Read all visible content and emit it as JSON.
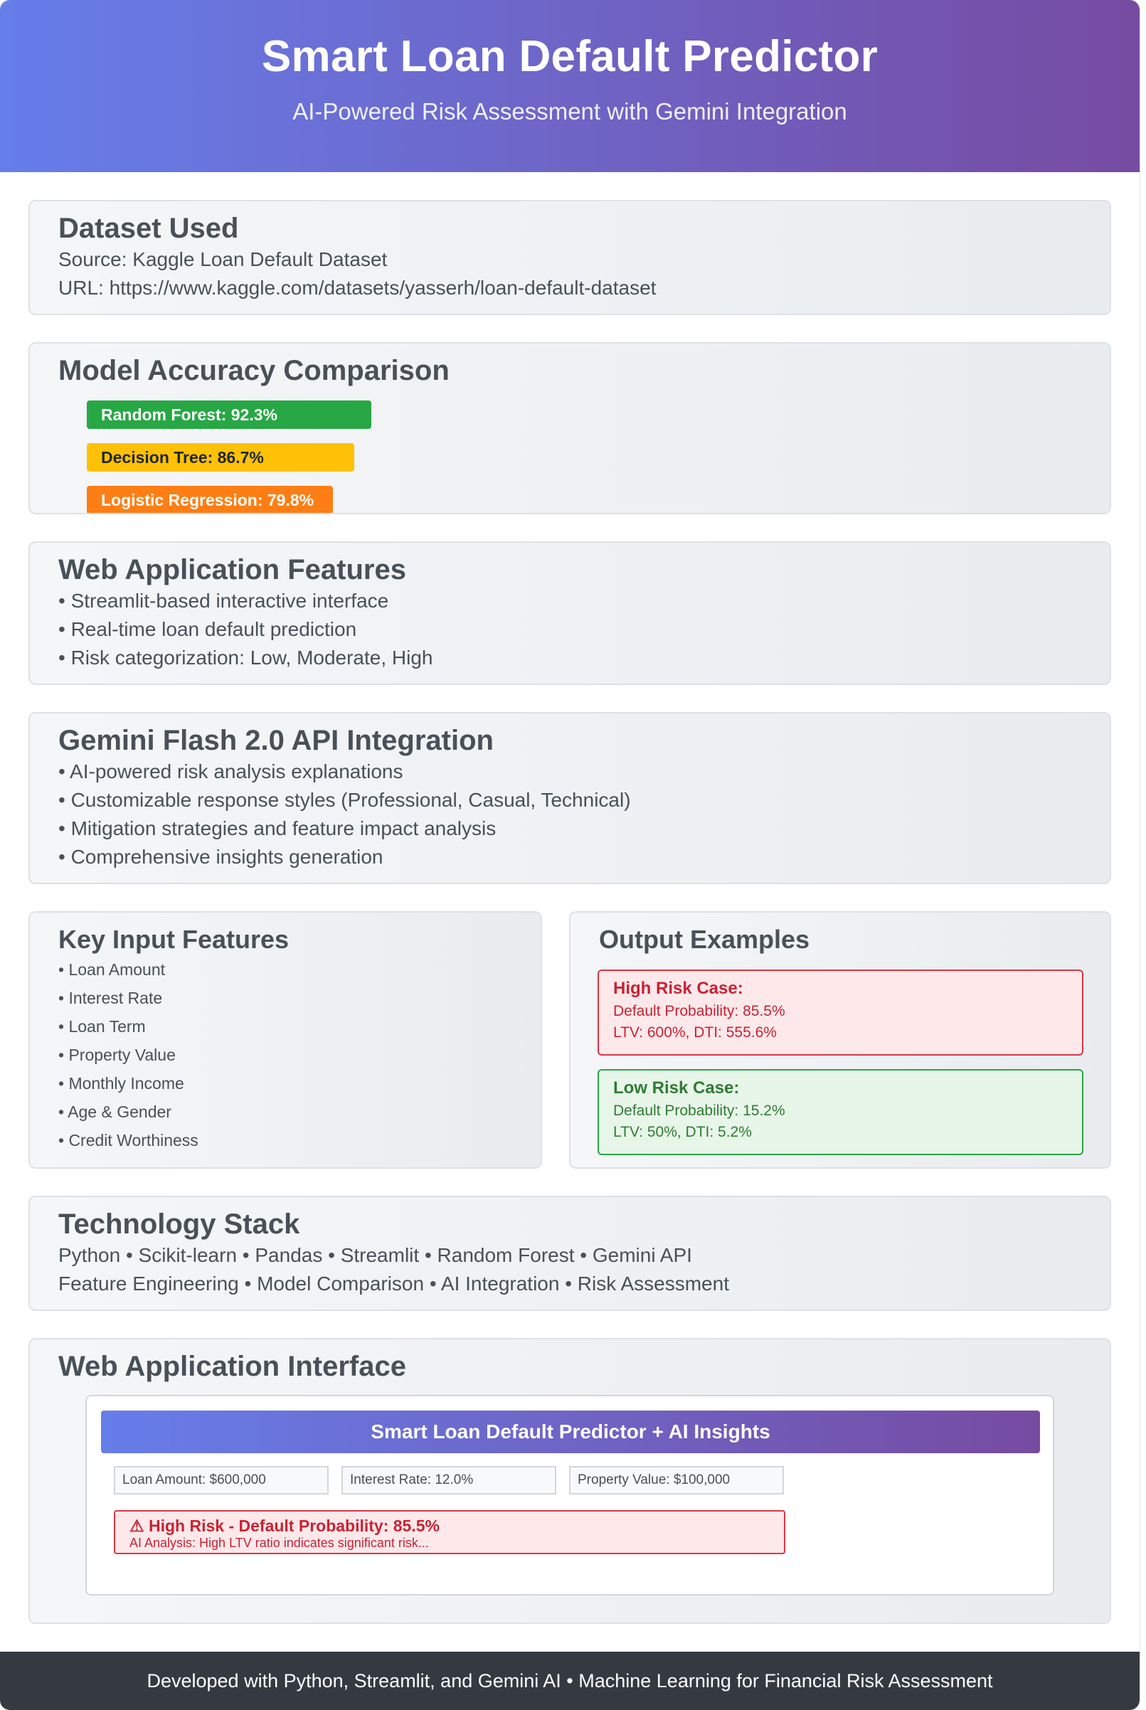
{
  "header": {
    "title": "Smart Loan Default Predictor",
    "subtitle": "AI-Powered Risk Assessment with Gemini Integration"
  },
  "dataset": {
    "heading": "Dataset Used",
    "source": "Source: Kaggle Loan Default Dataset",
    "url": "URL: https://www.kaggle.com/datasets/yasserh/loan-default-dataset"
  },
  "accuracy": {
    "heading": "Model Accuracy Comparison",
    "models": [
      {
        "label": "Random Forest: 92.3%",
        "value": 92.3,
        "color": "#28a745"
      },
      {
        "label": "Decision Tree: 86.7%",
        "value": 86.7,
        "color": "#ffc107"
      },
      {
        "label": "Logistic Regression: 79.8%",
        "value": 79.8,
        "color": "#fd7e14"
      }
    ]
  },
  "web_features": {
    "heading": "Web Application Features",
    "items": [
      "• Streamlit-based interactive interface",
      "• Real-time loan default prediction",
      "• Risk categorization: Low, Moderate, High"
    ]
  },
  "gemini": {
    "heading": "Gemini Flash 2.0 API Integration",
    "items": [
      "• AI-powered risk analysis explanations",
      "• Customizable response styles (Professional, Casual, Technical)",
      "• Mitigation strategies and feature impact analysis",
      "• Comprehensive insights generation"
    ]
  },
  "key_inputs": {
    "heading": "Key Input Features",
    "items": [
      "• Loan Amount",
      "• Interest Rate",
      "• Loan Term",
      "• Property Value",
      "• Monthly Income",
      "• Age & Gender",
      "• Credit Worthiness"
    ]
  },
  "outputs": {
    "heading": "Output Examples",
    "high": {
      "title": "High Risk Case:",
      "prob": "Default Probability: 85.5%",
      "ratios": "LTV: 600%, DTI: 555.6%"
    },
    "low": {
      "title": "Low Risk Case:",
      "prob": "Default Probability: 15.2%",
      "ratios": "LTV: 50%, DTI: 5.2%"
    }
  },
  "tech_stack": {
    "heading": "Technology Stack",
    "line1": "Python • Scikit-learn • Pandas • Streamlit • Random Forest • Gemini API",
    "line2": "Feature Engineering • Model Comparison • AI Integration • Risk Assessment"
  },
  "interface": {
    "heading": "Web Application Interface",
    "app_title": "Smart Loan Default Predictor + AI Insights",
    "fields": [
      "Loan Amount: $600,000",
      "Interest Rate: 12.0%",
      "Property Value: $100,000"
    ],
    "alert_title": "⚠ High Risk - Default Probability: 85.5%",
    "alert_detail": "AI Analysis: High LTV ratio indicates significant risk..."
  },
  "footer": {
    "text": "Developed with Python, Streamlit, and Gemini AI • Machine Learning for Financial Risk Assessment"
  }
}
